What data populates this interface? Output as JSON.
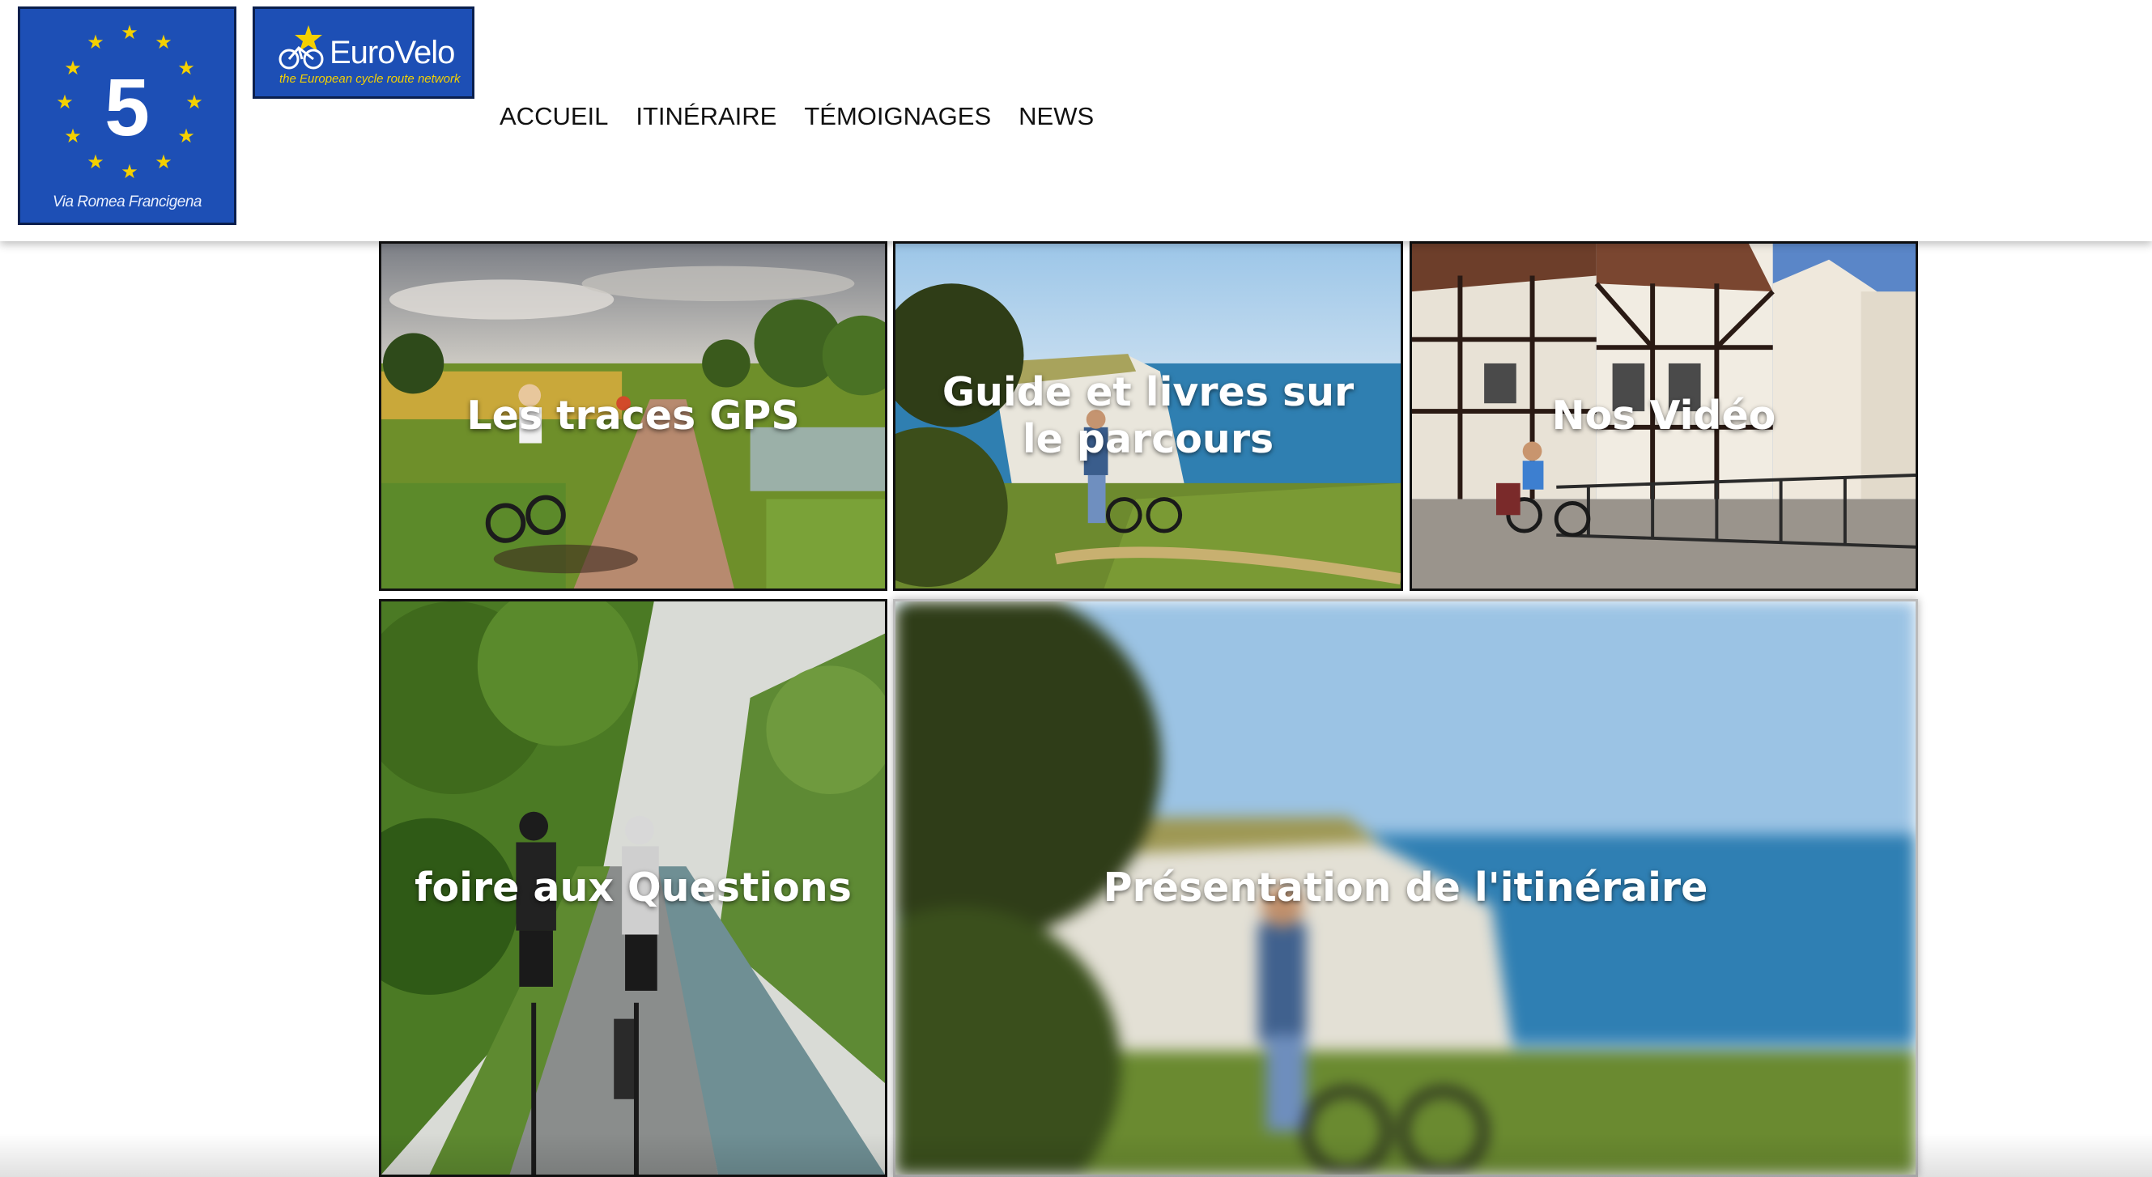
{
  "logos": {
    "ev5": {
      "number": "5",
      "caption": "Via Romea Francigena",
      "icon": "eurovelo-5-logo",
      "bg_color": "#1d4fb5",
      "star_color": "#f4d000"
    },
    "eurovelo": {
      "name": "EuroVelo",
      "tagline": "the European cycle route network",
      "icon": "eurovelo-logo"
    }
  },
  "nav": {
    "items": [
      {
        "label": "ACCUEIL"
      },
      {
        "label": "ITINÉRAIRE"
      },
      {
        "label": "TÉMOIGNAGES"
      },
      {
        "label": "NEWS"
      }
    ]
  },
  "tiles": [
    {
      "label": "Les traces GPS",
      "image": "cyclists-on-country-path-photo"
    },
    {
      "label": "Guide et livres sur le parcours",
      "image": "cyclist-on-cliff-by-sea-photo"
    },
    {
      "label": "Nos Vidéo",
      "image": "cyclist-timbered-houses-bridge-photo"
    },
    {
      "label": "foire aux Questions",
      "image": "two-cyclists-on-canal-path-photo"
    },
    {
      "label": "Présentation de l'itinéraire",
      "image": "blurred-cliff-cyclist-photo"
    }
  ]
}
